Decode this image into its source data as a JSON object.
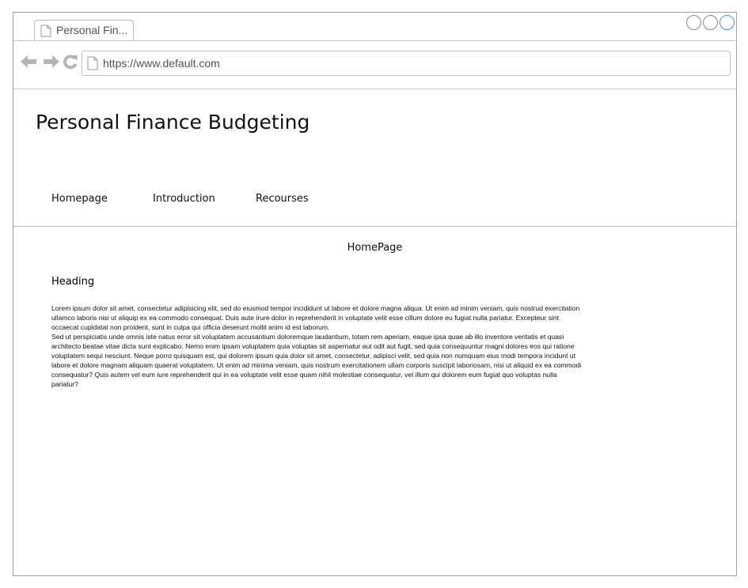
{
  "browser": {
    "tab_title": "Personal Fin...",
    "url": "https://www.default.com"
  },
  "site": {
    "title": "Personal Finance Budgeting",
    "nav": [
      "Homepage",
      "Introduction",
      "Recourses"
    ]
  },
  "content": {
    "page_name": "HomePage",
    "heading": "Heading",
    "paragraph_1": "Lorem ipsum dolor sit amet, consectetur adipisicing elit, sed do eiusmod tempor incididunt ut labore et dolore magna aliqua. Ut enim ad minim veniam, quis nostrud exercitation ullamco laboris nisi ut aliquip ex ea commodo consequat. Duis aute irure dolor in reprehenderit in voluptate velit esse cillum dolore eu fugiat nulla pariatur. Excepteur sint occaecat cupidatat non proident, sunt in culpa qui officia deserunt mollit anim id est laborum.",
    "paragraph_2": "Sed ut perspiciatis unde omnis iste natus error sit voluptatem accusantium doloremque laudantium, totam rem aperiam, eaque ipsa quae ab illo inventore veritatis et quasi architecto beatae vitae dicta sunt explicabo. Nemo enim ipsam voluptatem quia voluptas sit aspernatur aut odit aut fugit, sed quia consequuntur magni dolores eos qui ratione voluptatem sequi nesciunt. Neque porro quisquam est, qui dolorem ipsum quia dolor sit amet, consectetur, adipisci velit, sed quia non numquam eius modi tempora incidunt ut labore et dolore magnam aliquam quaerat voluptatem. Ut enim ad minima veniam, quis nostrum exercitationem ullam corporis suscipit laboriosam, nisi ut aliquid ex ea commodi consequatur? Quis autem vel eum iure reprehenderit qui in ea voluptate velit esse quam nihil molestiae consequatur, vel illum qui dolorem eum fugiat quo voluptas nulla pariatur?"
  },
  "icons": {
    "tab": "page-icon",
    "back": "back-arrow-icon",
    "forward": "forward-arrow-icon",
    "reload": "reload-icon",
    "url": "page-icon"
  },
  "colors": {
    "window_border": "#9e9e9e",
    "nav_icon": "#b5b5b5",
    "active_control": "#4a90d9"
  }
}
